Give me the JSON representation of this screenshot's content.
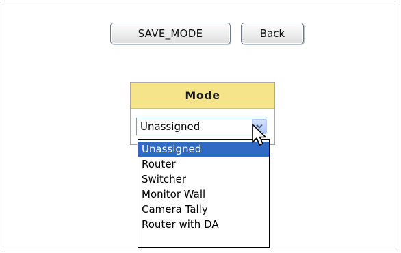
{
  "toolbar": {
    "save_label": "SAVE_MODE",
    "back_label": "Back"
  },
  "mode_panel": {
    "header": "Mode",
    "selected_value": "Unassigned",
    "options": [
      "Unassigned",
      "Router",
      "Switcher",
      "Monitor Wall",
      "Camera Tally",
      "Router with DA"
    ],
    "highlighted_option": "Unassigned"
  },
  "colors": {
    "header_bg": "#f6e48a",
    "highlight_bg": "#316ac5",
    "select_arrow_bg": "#a9c2f3"
  },
  "icons": {
    "dropdown_arrow": "chevron-down-icon",
    "pointer": "mouse-cursor-icon"
  }
}
